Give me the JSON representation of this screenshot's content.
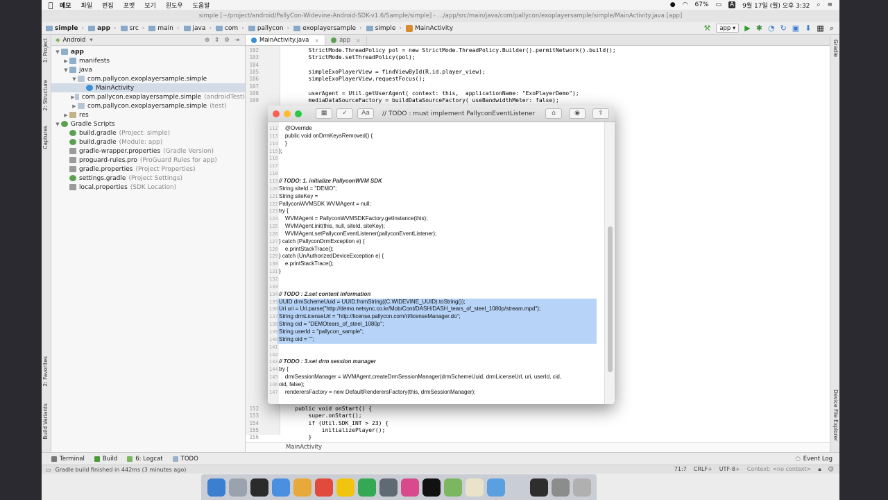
{
  "menubar": {
    "apple": "",
    "items": [
      "메모",
      "파일",
      "편집",
      "포맷",
      "보기",
      "윈도우",
      "도움말"
    ],
    "battery": "67%",
    "input_method": "A",
    "clock": "9월 17일 (월) 오후 3:32"
  },
  "window_title": "simple [~/project/android/PallyCon-Widevine-Android-SDK-v1.6/Sample/simple] - .../app/src/main/java/com/pallycon/exoplayersample/simple/MainActivity.java [app]",
  "breadcrumb": [
    "simple",
    "app",
    "src",
    "main",
    "java",
    "com",
    "pallycon",
    "exoplayersample",
    "simple",
    "MainActivity"
  ],
  "run_config": "app",
  "left_tabs": [
    "1: Project",
    "2: Structure",
    "Captures",
    "2: Favorites",
    "Build Variants"
  ],
  "right_tabs": [
    "Gradle",
    "Device File Explorer"
  ],
  "project": {
    "view_mode": "Android",
    "tree": [
      {
        "label": "app",
        "note": "",
        "icon": "folder",
        "level": 0,
        "arrow": "▼",
        "bold": true
      },
      {
        "label": "manifests",
        "note": "",
        "icon": "folder",
        "level": 1,
        "arrow": "▶",
        "bold": false
      },
      {
        "label": "java",
        "note": "",
        "icon": "folder",
        "level": 1,
        "arrow": "▼",
        "bold": false
      },
      {
        "label": "com.pallycon.exoplayersample.simple",
        "note": "",
        "icon": "pkg",
        "level": 2,
        "arrow": "▼",
        "bold": false
      },
      {
        "label": "MainActivity",
        "note": "",
        "icon": "cls",
        "level": 3,
        "arrow": "",
        "bold": false,
        "selected": true
      },
      {
        "label": "com.pallycon.exoplayersample.simple",
        "note": "(androidTest)",
        "icon": "pkg",
        "level": 2,
        "arrow": "▶",
        "bold": false
      },
      {
        "label": "com.pallycon.exoplayersample.simple",
        "note": "(test)",
        "icon": "pkg",
        "level": 2,
        "arrow": "▶",
        "bold": false
      },
      {
        "label": "res",
        "note": "",
        "icon": "res",
        "level": 1,
        "arrow": "▶",
        "bold": false
      },
      {
        "label": "Gradle Scripts",
        "note": "",
        "icon": "grad",
        "level": 0,
        "arrow": "▼",
        "bold": false
      },
      {
        "label": "build.gradle",
        "note": "(Project: simple)",
        "icon": "grad",
        "level": 1,
        "arrow": "",
        "bold": false
      },
      {
        "label": "build.gradle",
        "note": "(Module: app)",
        "icon": "grad",
        "level": 1,
        "arrow": "",
        "bold": false
      },
      {
        "label": "gradle-wrapper.properties",
        "note": "(Gradle Version)",
        "icon": "prop",
        "level": 1,
        "arrow": "",
        "bold": false
      },
      {
        "label": "proguard-rules.pro",
        "note": "(ProGuard Rules for app)",
        "icon": "prop",
        "level": 1,
        "arrow": "",
        "bold": false
      },
      {
        "label": "gradle.properties",
        "note": "(Project Properties)",
        "icon": "prop",
        "level": 1,
        "arrow": "",
        "bold": false
      },
      {
        "label": "settings.gradle",
        "note": "(Project Settings)",
        "icon": "grad",
        "level": 1,
        "arrow": "",
        "bold": false
      },
      {
        "label": "local.properties",
        "note": "(SDK Location)",
        "icon": "prop",
        "level": 1,
        "arrow": "",
        "bold": false
      }
    ]
  },
  "editor": {
    "tabs": [
      {
        "label": "MainActivity.java",
        "active": true
      },
      {
        "label": "app",
        "active": false
      }
    ],
    "lines_top": [
      {
        "n": "102",
        "t": "        StrictMode.ThreadPolicy pol = new StrictMode.ThreadPolicy.Builder().permitNetwork().build();"
      },
      {
        "n": "103",
        "t": "        StrictMode.setThreadPolicy(pol);"
      },
      {
        "n": "104",
        "t": ""
      },
      {
        "n": "105",
        "t": "        simpleExoPlayerView = findViewById(R.id.player_view);"
      },
      {
        "n": "106",
        "t": "        simpleExoPlayerView.requestFocus();"
      },
      {
        "n": "107",
        "t": ""
      },
      {
        "n": "108",
        "t": "        userAgent = Util.getUserAgent( context: this,  applicationName: \"ExoPlayerDemo\");"
      },
      {
        "n": "109",
        "t": "        mediaDataSourceFactory = buildDataSourceFactory( useBandwidthMeter: false);"
      }
    ],
    "lines_bottom": [
      {
        "n": "152",
        "t": "    public void onStart() {"
      },
      {
        "n": "153",
        "t": "        super.onStart();"
      },
      {
        "n": "154",
        "t": "        if (Util.SDK_INT > 23) {"
      },
      {
        "n": "155",
        "t": "            initializePlayer();"
      },
      {
        "n": "156",
        "t": "        }"
      },
      {
        "n": "157",
        "t": "    }"
      }
    ],
    "footer": "MainActivity"
  },
  "notes_window": {
    "title": "// TODO : must implement PallyconEventListener",
    "first_line": 112,
    "lines": [
      "    @Override",
      "    public void onDrmKeysRemoved() {",
      "    }",
      "};",
      "",
      "",
      "",
      "// TODO: 1. initialize PallyconWVM SDK",
      "String siteId = \"DEMO\";",
      "String siteKey = ",
      "PallyconWVMSDK WVMAgent = null;",
      "try {",
      "    WVMAgent = PallyconWVMSDKFactory.getInstance(this);",
      "    WVMAgent.init(this, null, siteId, siteKey);",
      "    WVMAgent.setPallyconEventListener(pallyconEventListener);",
      "} catch (PallyconDrmException e) {",
      "    e.printStackTrace();",
      "} catch (UnAuthorizedDeviceException e) {",
      "    e.printStackTrace();",
      "}",
      "",
      "",
      "// TODO : 2.set content information",
      "UUID drmSchemeUuid = UUID.fromString((C.WIDEVINE_UUID).toString());",
      "Uri uri = Uri.parse(\"http://demo.netsync.co.kr/Mob/Cont/DASH/DASH_tears_of_steel_1080p/stream.mpd\");",
      "String drmLicenseUrl = \"http://license.pallycon.com/ri/licenseManager.do\";",
      "String cid = \"DEMOtears_of_steel_1080p\";",
      "String userId = \"pallycon_sample\";",
      "String oid = \"\";",
      "",
      "",
      "// TODO : 3.set drm session manager",
      "try {",
      "    drmSessionManager = WVMAgent.createDrmSessionManager(drmSchemeUuid, drmLicenseUrl, uri, userId, cid,",
      "oid, false);",
      "    renderersFactory = new DefaultRenderersFactory(this, drmSessionManager);"
    ]
  },
  "bottom_tools": [
    "Terminal",
    "Build",
    "6: Logcat",
    "TODO"
  ],
  "event_log": "Event Log",
  "status": {
    "message": "Gradle build finished in 442ms (3 minutes ago)",
    "position": "71:7",
    "line_sep": "CRLF÷",
    "encoding": "UTF-8÷",
    "context": "Context: <no context>"
  },
  "dock_colors": [
    "#3b7fd0",
    "#9aa3ad",
    "#2b2b2b",
    "#4a8fe0",
    "#e8a93b",
    "#e24a3b",
    "#f1c40f",
    "#35a853",
    "#5f6a75",
    "#d94a8c",
    "#111111",
    "#7bb661",
    "#e9e4c9",
    "#5aa0e0",
    "#c9ced6",
    "#2e2e2e",
    "#8c8c8c",
    "#b0b0b0"
  ]
}
